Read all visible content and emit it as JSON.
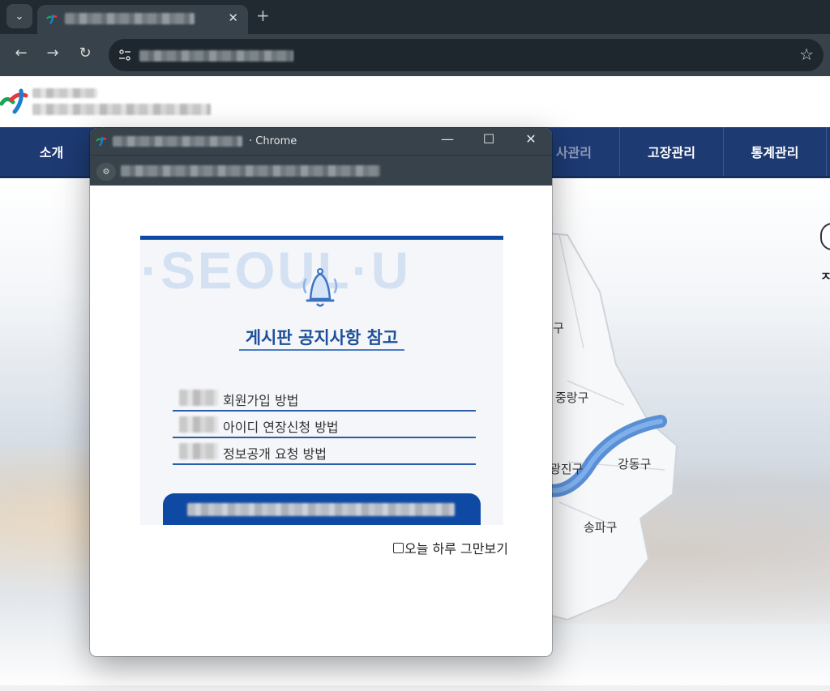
{
  "browser": {
    "tab_title_obscured": true,
    "url_obscured": true
  },
  "site": {
    "nav": [
      {
        "label": "소개"
      },
      {
        "label": "사관리"
      },
      {
        "label": "고장관리"
      },
      {
        "label": "통계관리"
      }
    ],
    "districts": [
      "구",
      "중랑구",
      "광진구",
      "강동구",
      "송파구"
    ],
    "side_text": "ㅈ"
  },
  "popup": {
    "app_name": "· Chrome",
    "notice": {
      "background_text": "I·SEOUL·U",
      "title": "게시판 공지사항 참고",
      "items": [
        {
          "label": "회원가입 방법"
        },
        {
          "label": "아이디 연장신청 방법"
        },
        {
          "label": "정보공개 요청 방법"
        }
      ]
    },
    "dismiss_label": "오늘 하루 그만보기"
  },
  "colors": {
    "nav_bg": "#1d3a73",
    "notice_blue": "#0e4aa3",
    "chrome_dark": "#202a30"
  }
}
